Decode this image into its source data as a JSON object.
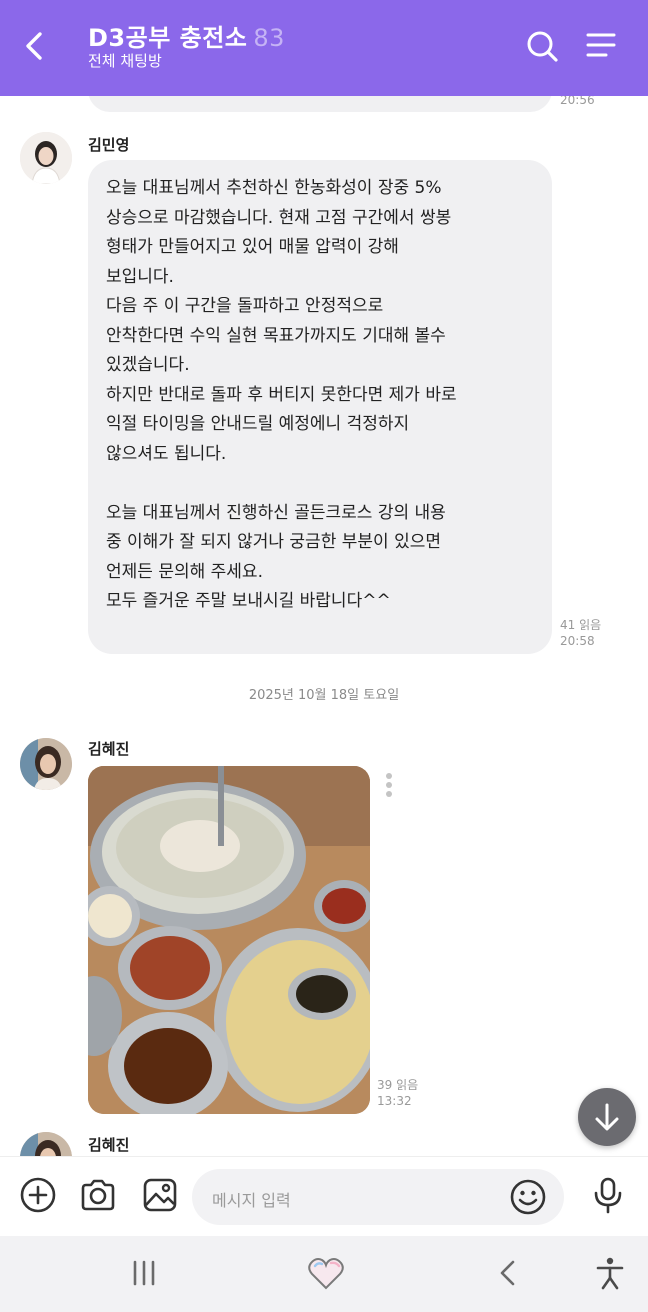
{
  "header": {
    "title": "D3공부 충전소",
    "member_count": "83",
    "subtitle": "전체 채팅방",
    "back_icon": "back-arrow-icon",
    "search_icon": "search-icon",
    "menu_icon": "menu-icon",
    "background_color": "#8b68ea"
  },
  "messages": [
    {
      "time": "20:56"
    },
    {
      "sender": "김민영",
      "lines": [
        "오늘 대표님께서 추천하신 한농화성이 장중 5%",
        "상승으로 마감했습니다. 현재 고점 구간에서 쌍봉",
        "형태가 만들어지고 있어 매물 압력이 강해",
        "보입니다.",
        "다음 주 이 구간을 돌파하고 안정적으로",
        "안착한다면 수익 실현 목표가까지도 기대해 볼수",
        "있겠습니다.",
        "하지만 반대로 돌파 후 버티지 못한다면 제가 바로",
        "익절 타이밍을 안내드릴 예정에니 걱정하지",
        "않으셔도 됩니다.",
        "",
        "오늘 대표님께서 진행하신 골든크로스 강의 내용",
        "중 이해가 잘 되지 않거나 궁금한 부분이 있으면",
        "언제든 문의해 주세요.",
        "모두 즐거운 주말 보내시길 바랍니다^^"
      ],
      "read": "41 읽음",
      "time": "20:58"
    },
    {
      "date_separator": "2025년 10월 18일 토요일"
    },
    {
      "sender": "김혜진",
      "photo_description": "image",
      "read": "39 읽음",
      "time": "13:32"
    },
    {
      "sender": "김혜진"
    }
  ],
  "input": {
    "placeholder": "메시지 입력",
    "add_icon": "plus-circle-icon",
    "camera_icon": "camera-icon",
    "gallery_icon": "gallery-icon",
    "emoji_icon": "emoji-icon",
    "mic_icon": "microphone-icon"
  },
  "scroll_down_icon": "arrow-down-icon",
  "system_nav": {
    "recents_icon": "recents-icon",
    "home_icon": "heart-home-icon",
    "back_icon": "nav-back-icon",
    "accessibility_icon": "accessibility-icon"
  }
}
